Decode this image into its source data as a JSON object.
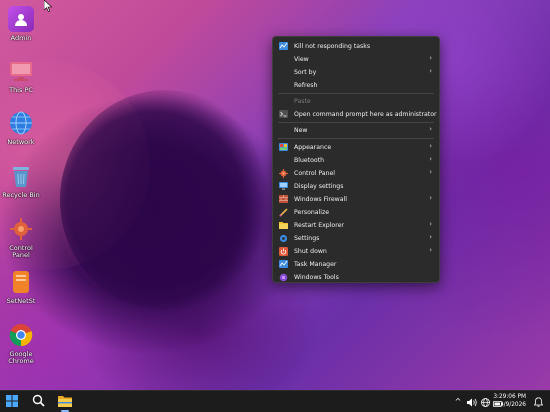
{
  "desktop_icons": [
    {
      "label": "Admin",
      "icon": "user-folder-icon",
      "color": "#b340d8"
    },
    {
      "label": "This PC",
      "icon": "computer-icon",
      "color": "#e05a7a"
    },
    {
      "label": "Network",
      "icon": "network-globe-icon",
      "color": "#3a8ee8"
    },
    {
      "label": "Recycle Bin",
      "icon": "recycle-bin-icon",
      "color": "#5a9ad0"
    },
    {
      "label": "Control Panel",
      "icon": "control-panel-icon",
      "color": "#e06040"
    },
    {
      "label": "SetNetSt",
      "icon": "document-icon",
      "color": "#f0822a"
    },
    {
      "label": "Google Chrome",
      "icon": "chrome-icon",
      "color": "#4285f4"
    }
  ],
  "context_menu": {
    "items": [
      {
        "label": "Kill not responding tasks",
        "icon": "task-manager-icon",
        "submenu": false
      },
      {
        "label": "View",
        "submenu": true
      },
      {
        "label": "Sort by",
        "submenu": true
      },
      {
        "label": "Refresh",
        "submenu": false
      },
      {
        "label": "Paste",
        "submenu": false,
        "disabled": true
      },
      {
        "label": "Open command prompt here as administrator",
        "icon": "cmd-icon",
        "submenu": false
      },
      {
        "label": "New",
        "submenu": true
      },
      {
        "label": "Appearance",
        "icon": "appearance-icon",
        "submenu": true
      },
      {
        "label": "Bluetooth",
        "submenu": true
      },
      {
        "label": "Control Panel",
        "icon": "control-panel-icon",
        "submenu": true
      },
      {
        "label": "Display settings",
        "icon": "display-icon",
        "submenu": false
      },
      {
        "label": "Windows Firewall",
        "icon": "firewall-icon",
        "submenu": true
      },
      {
        "label": "Personalize",
        "icon": "personalize-icon",
        "submenu": false
      },
      {
        "label": "Restart Explorer",
        "icon": "explorer-icon",
        "submenu": true
      },
      {
        "label": "Settings",
        "icon": "settings-icon",
        "submenu": true
      },
      {
        "label": "Shut down",
        "icon": "shutdown-icon",
        "submenu": true
      },
      {
        "label": "Task Manager",
        "icon": "task-manager-icon",
        "submenu": false
      },
      {
        "label": "Windows Tools",
        "icon": "windows-tools-icon",
        "submenu": false
      }
    ]
  },
  "taskbar": {
    "time": "3:29:06 PM",
    "date": "3/9/2026",
    "icons": [
      "windows-start-icon",
      "search-icon",
      "file-explorer-icon"
    ],
    "tray": [
      "chevron-up-icon",
      "speaker-icon",
      "globe-icon",
      "battery-icon",
      "notification-bell-icon"
    ]
  }
}
